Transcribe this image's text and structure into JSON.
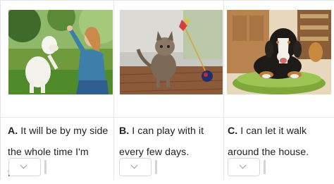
{
  "options": [
    {
      "letter": "A.",
      "text_line1": " It will be by my side",
      "text_line2": "the whole time I'm free.",
      "image_icon": "woman-with-white-dog-photo"
    },
    {
      "letter": "B.",
      "text_line1": " I can play with it",
      "text_line2": "every few days.",
      "image_icon": "kitten-with-toy-photo"
    },
    {
      "letter": "C.",
      "text_line1": " I can let it walk",
      "text_line2": "around the house.",
      "image_icon": "dog-on-cushion-photo"
    }
  ],
  "dropdown": {
    "selected": ""
  },
  "colors": {
    "border": "#e6e6e6",
    "text": "#222222"
  }
}
